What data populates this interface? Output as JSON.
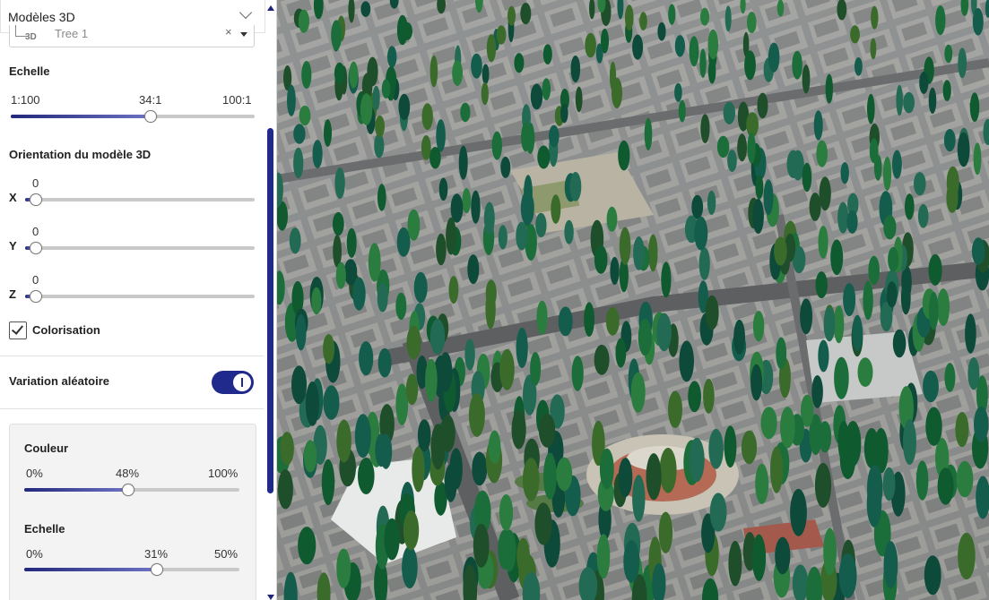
{
  "panel": {
    "title": "Modèles 3D",
    "model_select": {
      "icon_label": "3D",
      "value": "Tree 1",
      "clear": "×"
    },
    "scale": {
      "label": "Echelle",
      "min": "1:100",
      "value": "34:1",
      "max": "100:1",
      "fraction": 0.56
    },
    "orientation": {
      "label": "Orientation du modèle 3D",
      "axes": [
        {
          "name": "X",
          "value": "0"
        },
        {
          "name": "Y",
          "value": "0"
        },
        {
          "name": "Z",
          "value": "0"
        }
      ]
    },
    "colorisation": {
      "label": "Colorisation",
      "checked": true
    },
    "random_variation": {
      "label": "Variation aléatoire",
      "enabled": true
    },
    "color": {
      "label": "Couleur",
      "min": "0%",
      "value": "48%",
      "max": "100%",
      "fraction": 0.48
    },
    "variation_scale": {
      "label": "Echelle",
      "min": "0%",
      "value": "31%",
      "max": "50%",
      "fraction": 0.62
    }
  },
  "colors": {
    "accent": "#1f2a8c",
    "track": "#c9c9c9"
  }
}
